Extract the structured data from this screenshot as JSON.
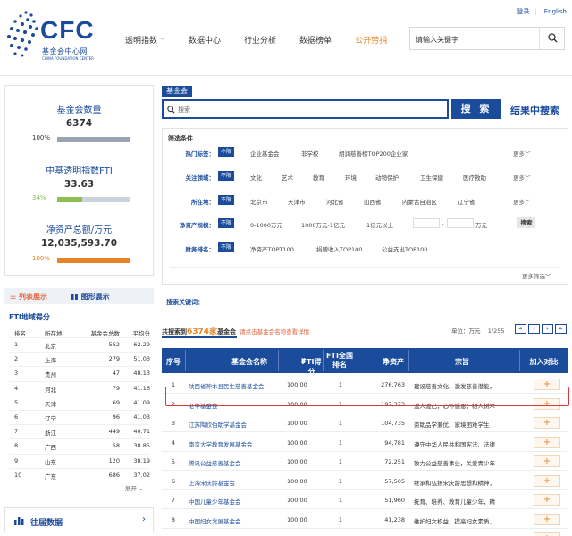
{
  "header": {
    "logo_text": "CFC",
    "logo_cn": "基金会中心网",
    "logo_en": "CHINA FOUNDATION CENTER",
    "top_links": [
      "登录",
      "English"
    ],
    "nav": [
      {
        "label": "透明指数",
        "has_menu": true
      },
      {
        "label": "数据中心",
        "has_menu": false
      },
      {
        "label": "行业分析",
        "has_menu": false
      },
      {
        "label": "数据榜单",
        "has_menu": false
      },
      {
        "label": "公开劳捐",
        "has_menu": false,
        "active": true
      }
    ],
    "search_placeholder": "请输入关键字"
  },
  "stats": {
    "fund_count_label": "基金会数量",
    "fund_count_value": "6374",
    "fund_count_pct": "100%",
    "fti_label": "中基透明指数FTI",
    "fti_value": "33.63",
    "fti_pct": "34%",
    "assets_label": "净资产总额/万元",
    "assets_value": "12,035,593.70",
    "assets_pct": "100%",
    "bar_fill_fraction": {
      "fund_count": 1.0,
      "fti": 0.34,
      "assets": 1.0
    },
    "colors": {
      "fund_count": "#9aa3b2",
      "fti": "#8cc152",
      "assets": "#e6842a"
    }
  },
  "left_tabs": {
    "list": "列表展示",
    "chart": "图形展示"
  },
  "fti_ranking": {
    "title": "FTI地域得分",
    "columns": [
      "排名",
      "所在地",
      "基金会总数",
      "平均分"
    ],
    "rows": [
      [
        "1",
        "北京",
        "552",
        "62.29"
      ],
      [
        "2",
        "上海",
        "279",
        "51.03"
      ],
      [
        "3",
        "贵州",
        "47",
        "48.13"
      ],
      [
        "4",
        "河北",
        "79",
        "41.16"
      ],
      [
        "5",
        "天津",
        "69",
        "41.09"
      ],
      [
        "6",
        "辽宁",
        "96",
        "41.03"
      ],
      [
        "7",
        "浙江",
        "449",
        "40.71"
      ],
      [
        "8",
        "广西",
        "58",
        "38.85"
      ],
      [
        "9",
        "山东",
        "120",
        "38.19"
      ],
      [
        "10",
        "广东",
        "686",
        "37.02"
      ]
    ],
    "expand_label": "展开"
  },
  "history": {
    "label": "往届数据"
  },
  "fund_search": {
    "tag": "基金会",
    "placeholder": "搜索",
    "button": "搜 索",
    "result_search": "结果中搜索"
  },
  "filters": {
    "title": "筛选条件",
    "no_limit": "不限",
    "more": "更多",
    "more_filter": "更多筛选",
    "rows": [
      {
        "label": "热门标签：",
        "options": [
          "企业基金会",
          "非学校",
          "胡润慈善榜TOP200企业家"
        ]
      },
      {
        "label": "关注领域：",
        "options": [
          "文化",
          "艺术",
          "教育",
          "环境",
          "动物保护",
          "卫生保健",
          "医疗救助"
        ]
      },
      {
        "label": "所在地：",
        "options": [
          "北京市",
          "天津市",
          "河北省",
          "山西省",
          "内蒙古自治区",
          "辽宁省"
        ]
      },
      {
        "label": "净资产规模：",
        "options": [
          "0-1000万元",
          "1000万元-1亿元",
          "1亿元以上"
        ],
        "range_unit": "万元",
        "range_button": "搜索"
      },
      {
        "label": "财务排名：",
        "options": [
          "净资产TOPT100",
          "捐赠收入TOP100",
          "公益支出TOP100"
        ]
      }
    ]
  },
  "keywords_label": "搜索关键词：",
  "results": {
    "prefix": "共搜索到",
    "count": "6374家",
    "suffix": "基金会",
    "hint": "请点击基金会名称查看详情",
    "unit": "单位：万元",
    "page": "1/255",
    "pager_buttons": [
      "«",
      "‹",
      "›",
      "»"
    ]
  },
  "table": {
    "columns": [
      "序号",
      "基金会名称",
      "FTI得分",
      "FTI全国排名",
      "净资产",
      "宗旨",
      "加入对比"
    ],
    "rows": [
      [
        "1",
        "陕西省神木县民生慈善基金会",
        "100.00",
        "1",
        "276,763",
        "建设慈善文化、激发慈善潜能，"
      ],
      [
        "2",
        "老牛基金会",
        "100.00",
        "1",
        "197,373",
        "渡人渡己，心怀感恩；树人树木"
      ],
      [
        "3",
        "江苏陶欣伯助学基金会",
        "100.00",
        "1",
        "104,735",
        "资助品学兼优、家境困难学生"
      ],
      [
        "4",
        "南京大学教育发展基金会",
        "100.00",
        "1",
        "94,781",
        "遵守中华人民共和国宪法、法律"
      ],
      [
        "5",
        "腾讯公益慈善基金会",
        "100.00",
        "1",
        "72,251",
        "致力公益慈善事业，关爱青少年"
      ],
      [
        "6",
        "上海宋庆龄基金会",
        "100.00",
        "1",
        "57,505",
        "继承和弘扬宋庆龄思想和精神，"
      ],
      [
        "7",
        "中国儿童少年基金会",
        "100.00",
        "1",
        "51,960",
        "抚育、培养、教育儿童少年，精"
      ],
      [
        "8",
        "中国妇女发展基金会",
        "100.00",
        "1",
        "41,238",
        "维护妇女权益，提高妇女素质，"
      ],
      [
        "9",
        "中华慈善基金会",
        "100.00",
        "1",
        "40,016",
        "弘扬民族精神，奉献中华爱心，"
      ]
    ],
    "add_symbol": "+",
    "highlighted_row": 2
  }
}
